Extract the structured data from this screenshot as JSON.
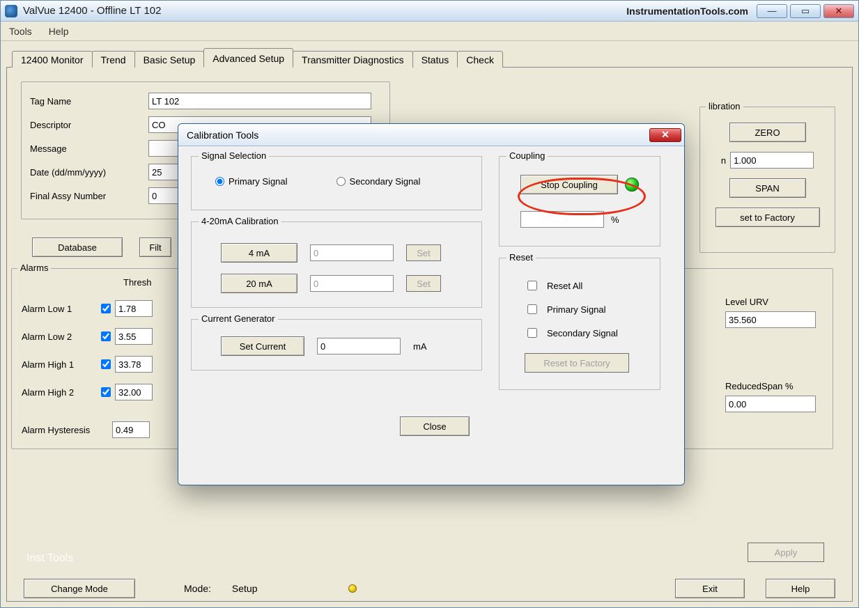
{
  "window": {
    "title": "ValVue 12400 - Offline  LT 102",
    "watermark": "InstrumentationTools.com",
    "min": "—",
    "max": "▭",
    "close": "✕"
  },
  "menu": {
    "tools": "Tools",
    "help": "Help"
  },
  "tabs": {
    "monitor": "12400 Monitor",
    "trend": "Trend",
    "basic": "Basic Setup",
    "advanced": "Advanced Setup",
    "diag": "Transmitter Diagnostics",
    "status": "Status",
    "check": "Check"
  },
  "fields": {
    "tag_label": "Tag Name",
    "tag_value": "LT 102",
    "desc_label": "Descriptor",
    "desc_value": "CO",
    "msg_label": "Message",
    "msg_value": "",
    "date_label": "Date (dd/mm/yyyy)",
    "date_value": "25",
    "assy_label": "Final Assy Number",
    "assy_value": "0"
  },
  "buttons": {
    "database": "Database",
    "filt": "Filt"
  },
  "alarms": {
    "legend": "Alarms",
    "thresh": "Thresh",
    "low1": "Alarm Low 1",
    "low1v": "1.78",
    "low2": "Alarm Low 2",
    "low2v": "3.55",
    "high1": "Alarm High 1",
    "high1v": "33.78",
    "high2": "Alarm High 2",
    "high2v": "32.00",
    "hyst": "Alarm Hysteresis",
    "hystv": "0.49"
  },
  "calibration": {
    "legend": "libration",
    "zero": "ZERO",
    "span": "SPAN",
    "n_label": "n",
    "n_value": "1.000",
    "reset_factory": "set to Factory",
    "urv_label": "Level URV",
    "urv_value": "35.560",
    "reduced_label": "ReducedSpan %",
    "reduced_value": "0.00",
    "apply": "Apply"
  },
  "bottom": {
    "change_mode": "Change Mode",
    "mode_label": "Mode:",
    "mode_value": "Setup",
    "exit": "Exit",
    "help": "Help"
  },
  "watermark_corner": "Inst Tools",
  "dialog": {
    "title": "Calibration Tools",
    "close_x": "✕",
    "signal": {
      "legend": "Signal Selection",
      "primary": "Primary Signal",
      "secondary": "Secondary Signal"
    },
    "cal420": {
      "legend": "4-20mA Calibration",
      "b4": "4 mA",
      "v4": "0",
      "set4": "Set",
      "b20": "20 mA",
      "v20": "0",
      "set20": "Set"
    },
    "curgen": {
      "legend": "Current Generator",
      "set_current": "Set Current",
      "val": "0",
      "unit": "mA"
    },
    "coupling": {
      "legend": "Coupling",
      "stop": "Stop Coupling",
      "pct_val": "",
      "pct_unit": "%"
    },
    "reset": {
      "legend": "Reset",
      "all": "Reset All",
      "primary": "Primary Signal",
      "secondary": "Secondary Signal",
      "factory": "Reset to Factory"
    },
    "close": "Close"
  }
}
